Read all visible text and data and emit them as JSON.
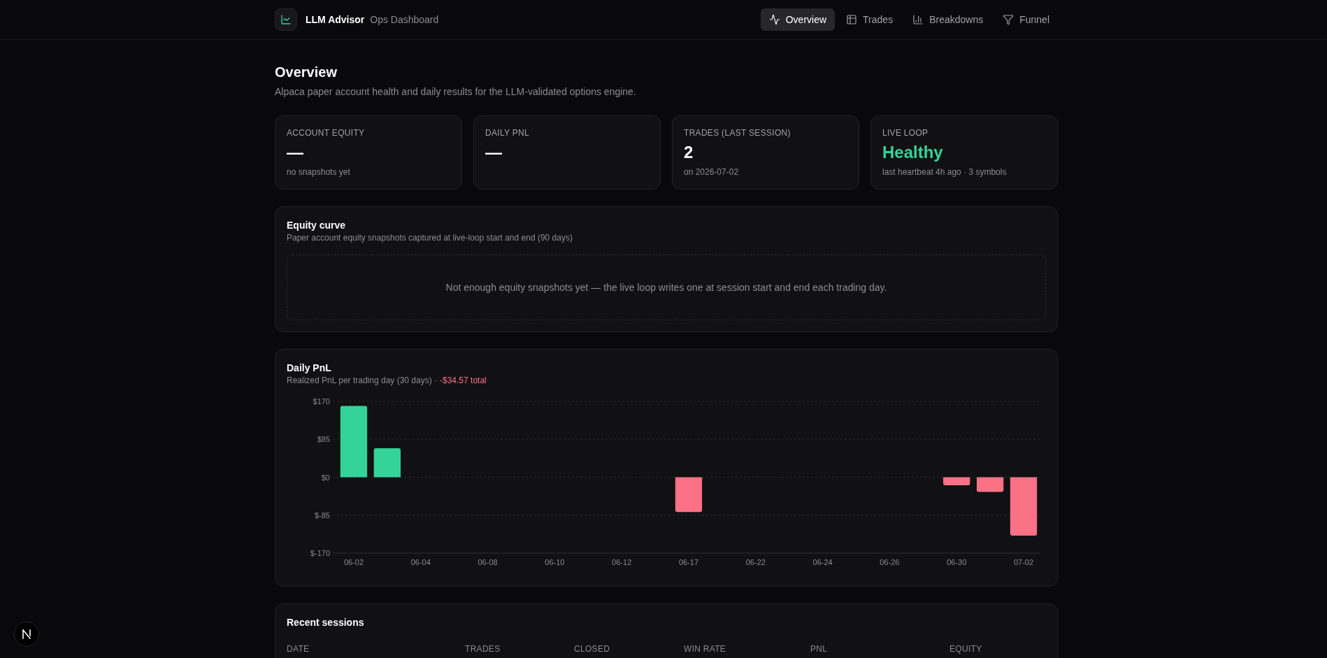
{
  "header": {
    "brand": "LLM Advisor",
    "subtitle": "Ops Dashboard",
    "nav": [
      {
        "label": "Overview",
        "selected": true
      },
      {
        "label": "Trades",
        "selected": false
      },
      {
        "label": "Breakdowns",
        "selected": false
      },
      {
        "label": "Funnel",
        "selected": false
      }
    ]
  },
  "page": {
    "title": "Overview",
    "subtitle": "Alpaca paper account health and daily results for the LLM-validated options engine."
  },
  "stats": [
    {
      "label": "ACCOUNT EQUITY",
      "value": "—",
      "note": "no snapshots yet"
    },
    {
      "label": "DAILY PNL",
      "value": "—"
    },
    {
      "label": "TRADES (LAST SESSION)",
      "value": "2",
      "note": "on 2026-07-02"
    },
    {
      "label": "LIVE LOOP",
      "value": "Healthy",
      "note": "last heartbeat 4h ago · 3 symbols",
      "color": "#34d399"
    }
  ],
  "equity_curve": {
    "title": "Equity curve",
    "subtitle": "Paper account equity snapshots captured at live-loop start and end (90 days)",
    "empty_message": "Not enough equity snapshots yet — the live loop writes one at session start and end each trading day."
  },
  "daily_pnl": {
    "title": "Daily PnL",
    "subtitle": "Realized PnL per trading day (30 days) ·",
    "total": {
      "text": "-$34.57 total",
      "negative": true
    },
    "chart_data": {
      "type": "bar",
      "categories": [
        "06-02",
        null,
        "06-04",
        null,
        "06-08",
        null,
        "06-10",
        null,
        "06-12",
        null,
        "06-17",
        null,
        "06-22",
        null,
        "06-24",
        null,
        "06-26",
        null,
        "06-30",
        null,
        "07-02"
      ],
      "values": [
        160,
        65,
        null,
        null,
        null,
        null,
        null,
        null,
        null,
        null,
        -78,
        null,
        null,
        null,
        null,
        null,
        null,
        null,
        -18,
        -33,
        -131
      ],
      "ylim": [
        -170,
        170
      ],
      "yticks": [
        {
          "value": 170,
          "label": "$170"
        },
        {
          "value": 85,
          "label": "$85"
        },
        {
          "value": 0,
          "label": "$0"
        },
        {
          "value": -85,
          "label": "$-85"
        },
        {
          "value": -170,
          "label": "$-170"
        }
      ],
      "grid": true
    }
  },
  "recent_sessions": {
    "title": "Recent sessions",
    "columns": [
      "DATE",
      "TRADES",
      "CLOSED",
      "WIN RATE",
      "PNL",
      "EQUITY"
    ]
  }
}
